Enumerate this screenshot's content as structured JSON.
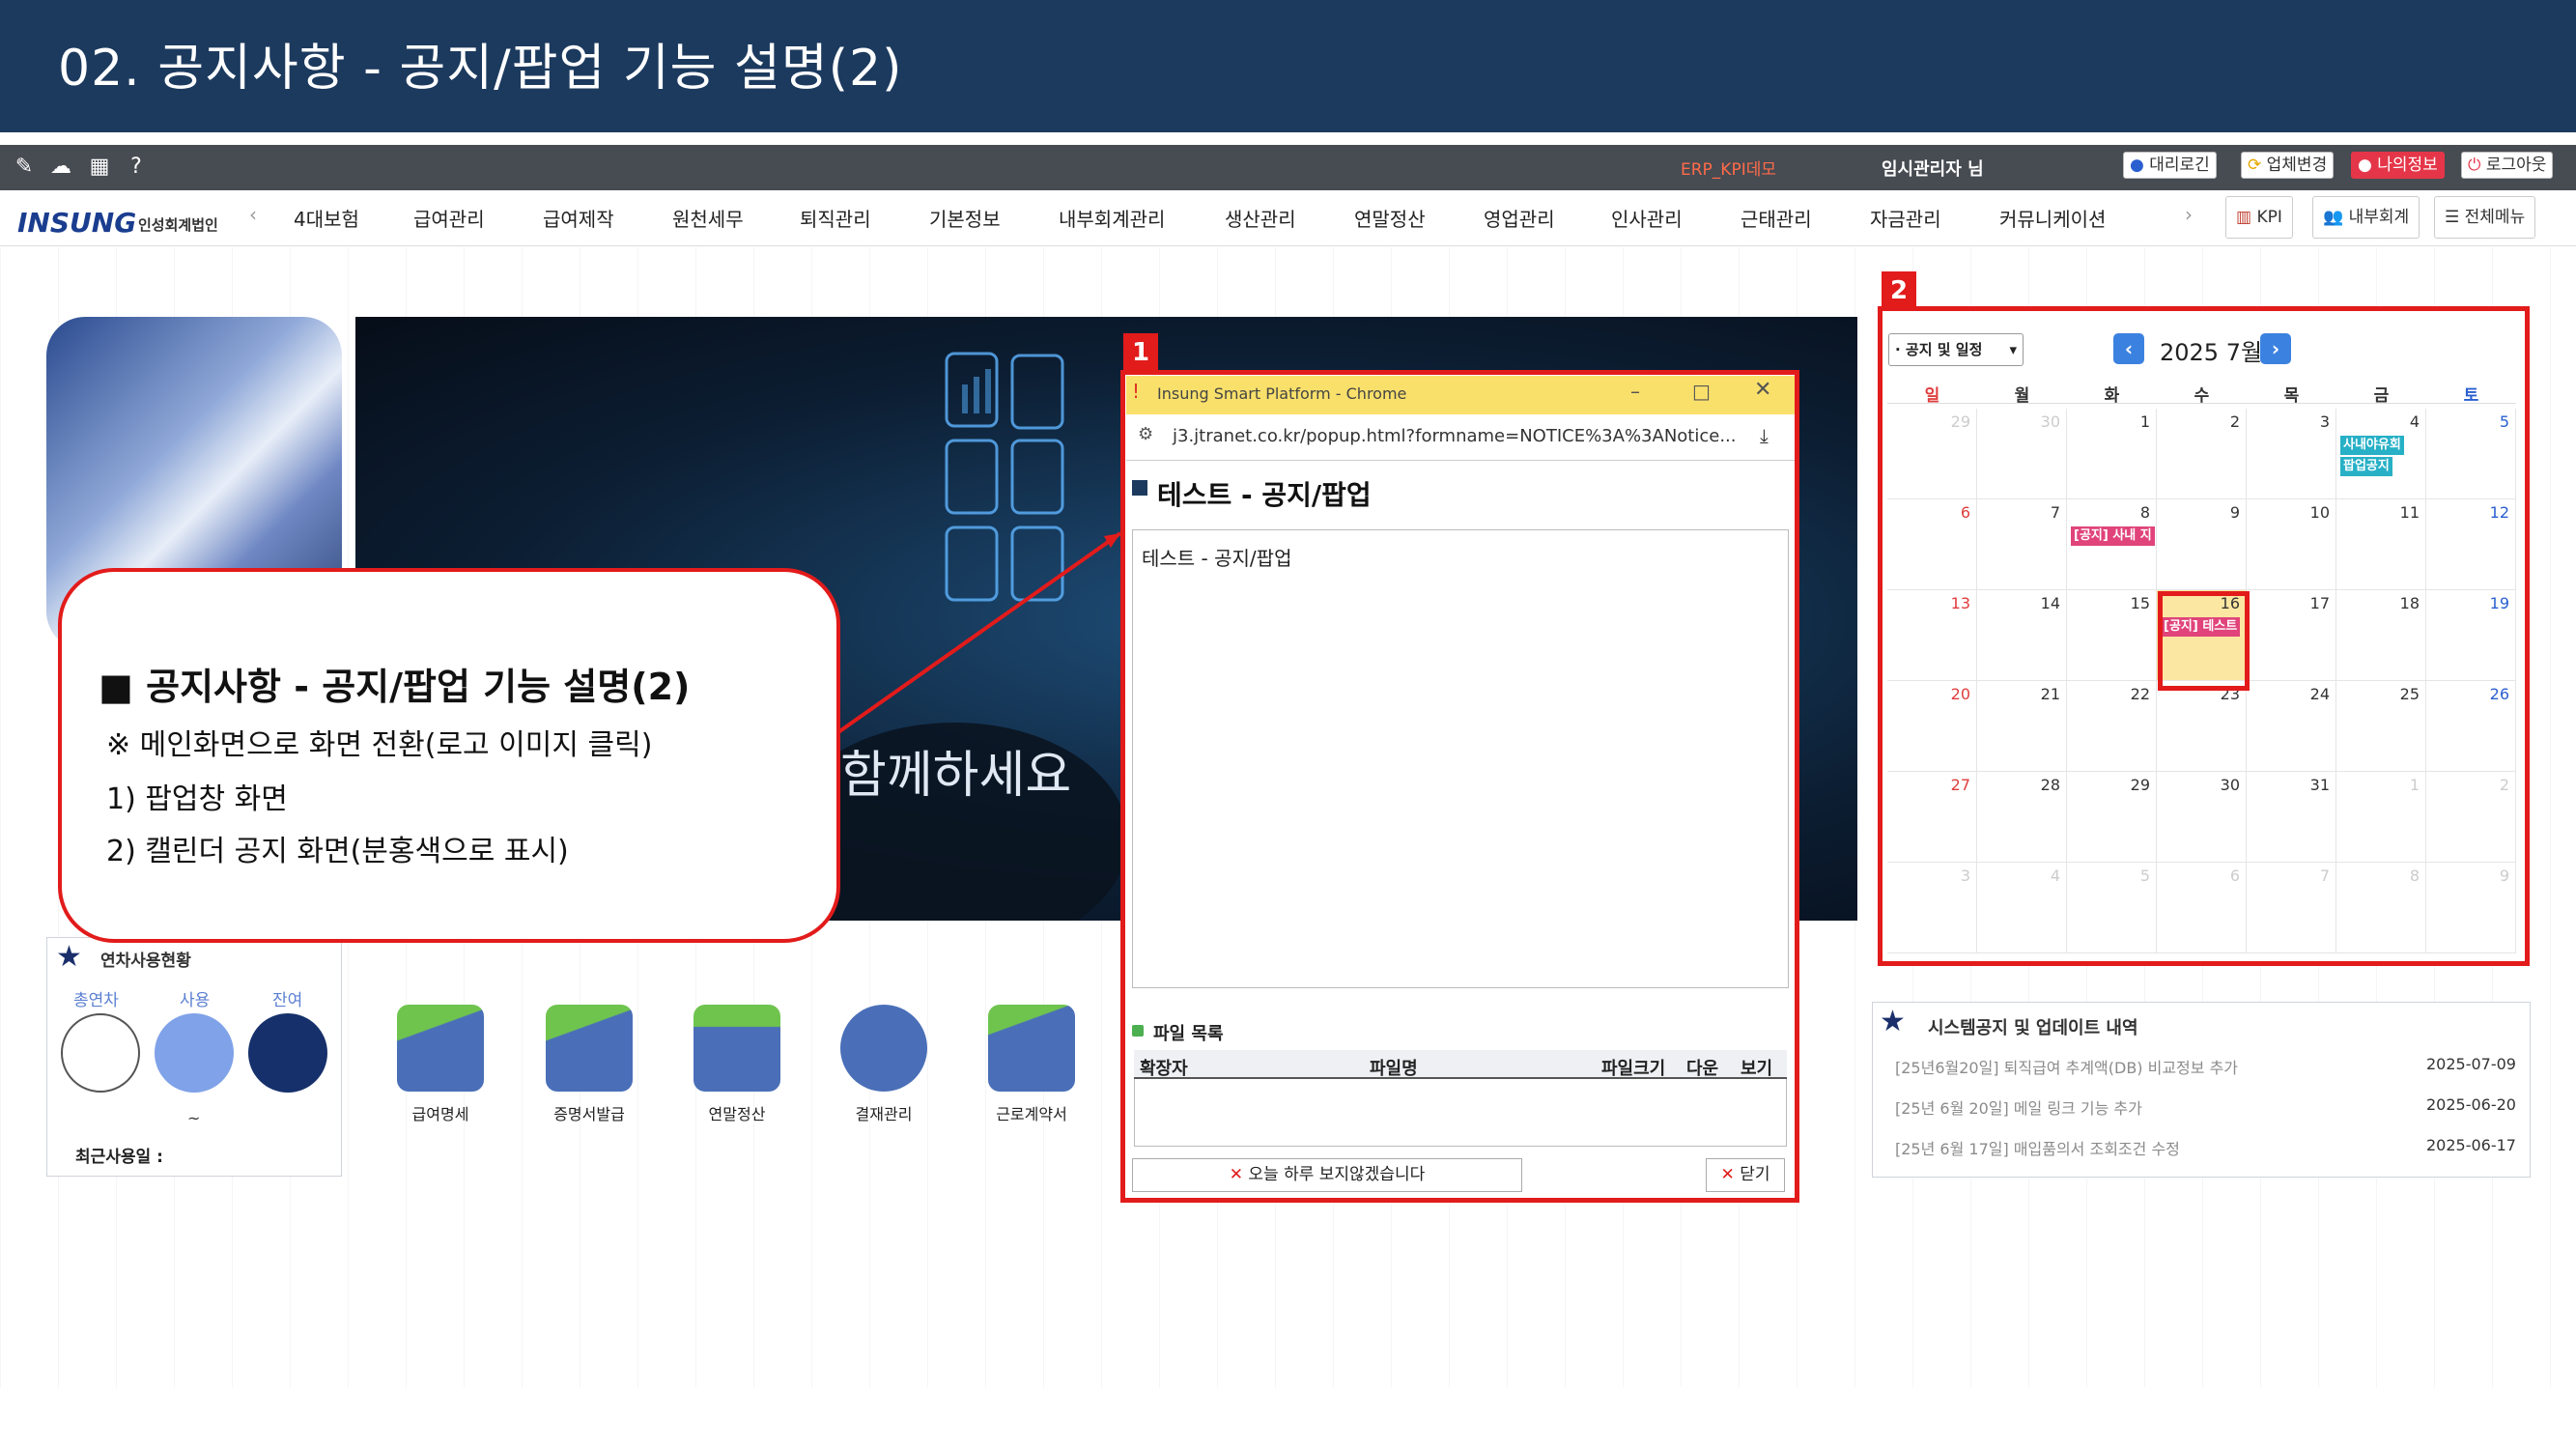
{
  "slide": {
    "title": "02. 공지사항 - 공지/팝업 기능 설명(2)"
  },
  "topbar": {
    "erp_demo": "ERP_KPI데모",
    "admin_name": "임시관리자 님",
    "buttons": {
      "proxy_login": "대리로긴",
      "company_change": "업체변경",
      "my_info": "나의정보",
      "logout": "로그아웃"
    },
    "icons": [
      "edit-icon",
      "cloud-icon",
      "grid-icon",
      "help-icon"
    ]
  },
  "menubar": {
    "logo": "INSUNG",
    "logo_sub": "인성회계법인",
    "items": [
      "4대보험",
      "급여관리",
      "급여제작",
      "원천세무",
      "퇴직관리",
      "기본정보",
      "내부회계관리",
      "생산관리",
      "연말정산",
      "영업관리",
      "인사관리",
      "근태관리",
      "자금관리",
      "커뮤니케이션"
    ],
    "right": {
      "kpi": "KPI",
      "internal": "내부회계",
      "all_menu": "전체메뉴"
    }
  },
  "banner": {
    "text": "함께하세요"
  },
  "callout": {
    "title": "■ 공지사항 - 공지/팝업 기능 설명(2)",
    "lines": [
      "※ 메인화면으로 화면 전환(로고 이미지 클릭)",
      "1) 팝업창 화면",
      "2) 캘린더 공지 화면(분홍색으로 표시)"
    ]
  },
  "leave": {
    "title": "연차사용현황",
    "labels": [
      "총연차",
      "사용",
      "잔여"
    ],
    "tilde": "~",
    "recent": "최근사용일 :"
  },
  "quick_links": [
    "급여명세",
    "증명서발급",
    "연말정산",
    "결재관리",
    "근로계약서"
  ],
  "popup": {
    "badge": "1",
    "window_title": "Insung Smart Platform - Chrome",
    "url": "j3.jtranet.co.kr/popup.html?formname=NOTICE%3A%3ANotice...",
    "heading": "테스트 - 공지/팝업",
    "body": "테스트 - 공지/팝업",
    "file_list_label": "파일 목록",
    "file_columns": [
      "확장자",
      "파일명",
      "파일크기",
      "다운",
      "보기"
    ],
    "dont_show": "오늘 하루 보지않겠습니다",
    "close": "닫기"
  },
  "calendar": {
    "badge": "2",
    "filter": "· 공지 및 일정",
    "month": "2025 7월",
    "dow": [
      "일",
      "월",
      "화",
      "수",
      "목",
      "금",
      "토"
    ],
    "weeks": [
      [
        "29",
        "30",
        "1",
        "2",
        "3",
        "4",
        "5"
      ],
      [
        "6",
        "7",
        "8",
        "9",
        "10",
        "11",
        "12"
      ],
      [
        "13",
        "14",
        "15",
        "16",
        "17",
        "18",
        "19"
      ],
      [
        "20",
        "21",
        "22",
        "23",
        "24",
        "25",
        "26"
      ],
      [
        "27",
        "28",
        "29",
        "30",
        "31",
        "1",
        "2"
      ],
      [
        "3",
        "4",
        "5",
        "6",
        "7",
        "8",
        "9"
      ]
    ],
    "events": [
      {
        "week": 0,
        "day": 5,
        "label": "사내야유회",
        "kind": "teal"
      },
      {
        "week": 0,
        "day": 5,
        "label": "팝업공지",
        "kind": "teal"
      },
      {
        "week": 1,
        "day": 2,
        "label": "[공지] 사내 지",
        "kind": "pink"
      },
      {
        "week": 2,
        "day": 3,
        "label": "[공지] 테스트",
        "kind": "pink"
      }
    ],
    "colors": {
      "today": "#fbe7a1",
      "event_pink": "#e0447a",
      "event_teal": "#27b0c6"
    }
  },
  "notices": {
    "title": "시스템공지 및 업데이트 내역",
    "items": [
      {
        "text": "[25년6월20일] 퇴직급여 추계액(DB) 비교정보 추가",
        "date": "2025-07-09"
      },
      {
        "text": "[25년 6월 20일] 메일 링크 기능 추가",
        "date": "2025-06-20"
      },
      {
        "text": "[25년 6월 17일] 매입품의서 조회조건 수정",
        "date": "2025-06-17"
      }
    ]
  }
}
